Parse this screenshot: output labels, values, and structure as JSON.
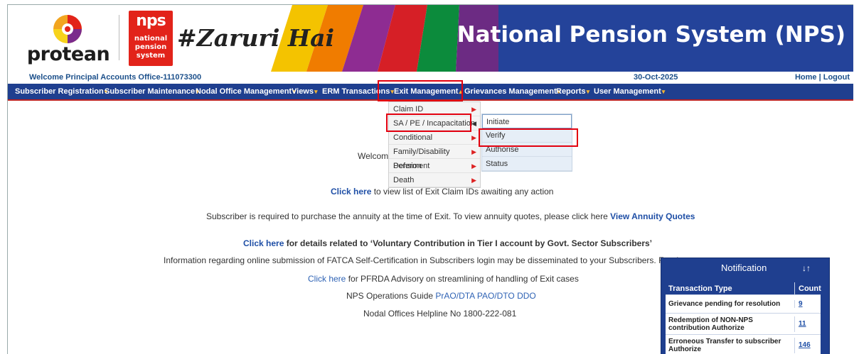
{
  "banner": {
    "protean_text": "protean",
    "nps_big": "nps",
    "nps_lines": [
      "national",
      "pension",
      "system"
    ],
    "tagline": "#Zaruri Hai",
    "title": "National Pension System (NPS)"
  },
  "infobar": {
    "welcome": "Welcome Principal Accounts Office-111073300",
    "date": "30-Oct-2025",
    "home": "Home",
    "sep": " | ",
    "logout": "Logout"
  },
  "nav": {
    "items": [
      {
        "label": "Subscriber Registration"
      },
      {
        "label": "Subscriber Maintenance"
      },
      {
        "label": "Nodal Office Management"
      },
      {
        "label": "Views"
      },
      {
        "label": "ERM Transactions"
      },
      {
        "label": "Exit Management"
      },
      {
        "label": "Grievances Management"
      },
      {
        "label": "Reports"
      },
      {
        "label": "User Management"
      }
    ],
    "caret_down": "▾",
    "caret_up": "▴"
  },
  "exit_menu": {
    "items": [
      {
        "label": "Claim ID"
      },
      {
        "label": "SA / PE / Incapacitation"
      },
      {
        "label": "Conditional"
      },
      {
        "label": "Family/Disability Pension"
      },
      {
        "label": "Deferment"
      },
      {
        "label": "Death"
      }
    ],
    "submenu": [
      {
        "label": "Initiate"
      },
      {
        "label": "Verify"
      },
      {
        "label": "Authorise"
      },
      {
        "label": "Status"
      }
    ]
  },
  "content": {
    "welcome_partial": "Welcome",
    "claim_link": "Click here",
    "claim_text": " to view list of Exit Claim IDs awaiting any action",
    "annuity_text": "Subscriber is required to purchase the annuity at the time of Exit. To view annuity quotes, please click here ",
    "annuity_link": "View Annuity Quotes",
    "voluntary_link": "Click here",
    "voluntary_text": " for details related to ‘Voluntary Contribution in Tier I account by Govt. Sector Subscribers’",
    "fatca_text": "Information regarding online submission of FATCA Self-Certification in Subscribers login may be disseminated to your Subscribers. For deta",
    "pfrda_link": "Click here",
    "pfrda_text": " for PFRDA Advisory on streamlining of handling of Exit cases",
    "guide_text": "NPS Operations Guide ",
    "guide_link": "PrAO/DTA PAO/DTO DDO",
    "helpline": "Nodal Offices Helpline No 1800-222-081"
  },
  "notification": {
    "title": "Notification",
    "sort_icon": "↓↑",
    "col_type": "Transaction Type",
    "col_count": "Count",
    "rows": [
      {
        "type": "Grievance pending for resolution",
        "count": "9"
      },
      {
        "type": "Redemption of NON-NPS contribution Authorize",
        "count": "11"
      },
      {
        "type": "Erroneous Transfer to subscriber Authorize",
        "count": "146"
      }
    ]
  },
  "colors": {
    "nav_bg": "#1f3f8f",
    "highlight": "#e3000f",
    "link": "#1f4fa6"
  }
}
